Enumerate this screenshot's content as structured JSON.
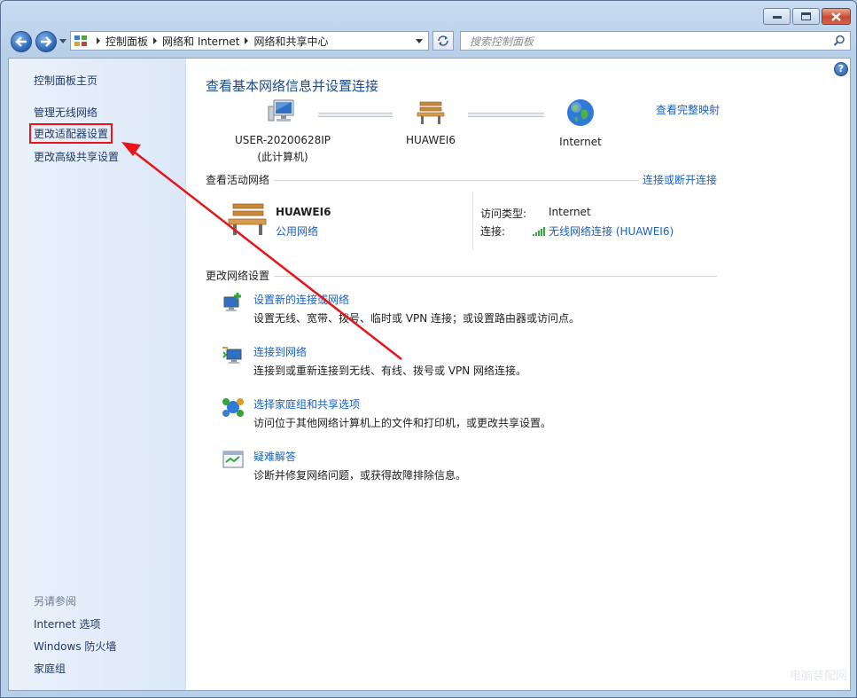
{
  "window": {
    "minimize_label": "",
    "maximize_label": "",
    "close_label": ""
  },
  "address": {
    "crumbs": [
      "控制面板",
      "网络和 Internet",
      "网络和共享中心"
    ]
  },
  "search": {
    "placeholder": "搜索控制面板"
  },
  "sidebar": {
    "items": [
      {
        "label": "控制面板主页"
      },
      {
        "label": "管理无线网络"
      },
      {
        "label": "更改适配器设置"
      },
      {
        "label": "更改高级共享设置"
      }
    ],
    "see_also_heading": "另请参阅",
    "see_also": [
      {
        "label": "Internet 选项"
      },
      {
        "label": "Windows 防火墙"
      },
      {
        "label": "家庭组"
      }
    ]
  },
  "main": {
    "title": "查看基本网络信息并设置连接",
    "map_link": "查看完整映射",
    "nodes": [
      {
        "line1": "USER-20200628IP",
        "line2": "(此计算机)"
      },
      {
        "line1": "HUAWEI6",
        "line2": ""
      },
      {
        "line1": "Internet",
        "line2": ""
      }
    ],
    "active_networks": {
      "title": "查看活动网络",
      "action_link": "连接或断开连接",
      "network_name": "HUAWEI6",
      "network_type": "公用网络",
      "access_type_label": "访问类型:",
      "access_type_value": "Internet",
      "connection_label": "连接:",
      "connection_value": "无线网络连接 (HUAWEI6)"
    },
    "change_settings": {
      "title": "更改网络设置",
      "tasks": [
        {
          "link": "设置新的连接或网络",
          "desc": "设置无线、宽带、拨号、临时或 VPN 连接；或设置路由器或访问点。",
          "icon": "new-connection-icon"
        },
        {
          "link": "连接到网络",
          "desc": "连接到或重新连接到无线、有线、拨号或 VPN 网络连接。",
          "icon": "connect-network-icon"
        },
        {
          "link": "选择家庭组和共享选项",
          "desc": "访问位于其他网络计算机上的文件和打印机，或更改共享设置。",
          "icon": "homegroup-icon"
        },
        {
          "link": "疑难解答",
          "desc": "诊断并修复网络问题，或获得故障排除信息。",
          "icon": "troubleshoot-icon"
        }
      ]
    }
  },
  "watermark": "电脑装配网",
  "colors": {
    "link": "#1a61c2",
    "highlight_box": "#e8141c",
    "annotation_arrow": "#e8141c",
    "sidebar_bg": "#dce8f7",
    "title": "#1c4a87"
  }
}
